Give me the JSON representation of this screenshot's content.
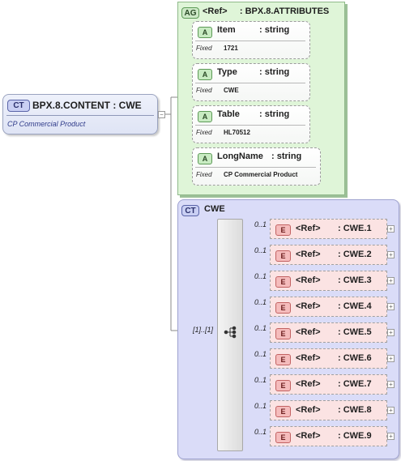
{
  "root": {
    "badge": "CT",
    "title": "BPX.8.CONTENT : CWE",
    "doc": "CP Commercial Product"
  },
  "attribute_group": {
    "badge": "AG",
    "title": "<Ref>     : BPX.8.ATTRIBUTES",
    "attributes": [
      {
        "badge": "A",
        "name": "Item",
        "type": ": string",
        "fixed_label": "Fixed",
        "fixed_value": "1721"
      },
      {
        "badge": "A",
        "name": "Type",
        "type": ": string",
        "fixed_label": "Fixed",
        "fixed_value": "CWE"
      },
      {
        "badge": "A",
        "name": "Table",
        "type": ": string",
        "fixed_label": "Fixed",
        "fixed_value": "HL70512"
      },
      {
        "badge": "A",
        "name": "LongName",
        "type": ": string",
        "fixed_label": "Fixed",
        "fixed_value": "CP Commercial Product"
      }
    ]
  },
  "complex_type": {
    "badge": "CT",
    "title": "CWE",
    "sequence_cardinality": "[1]..[1]",
    "elements": [
      {
        "badge": "E",
        "ref": "<Ref>",
        "type": ": CWE.1",
        "cardinality": "0..1"
      },
      {
        "badge": "E",
        "ref": "<Ref>",
        "type": ": CWE.2",
        "cardinality": "0..1"
      },
      {
        "badge": "E",
        "ref": "<Ref>",
        "type": ": CWE.3",
        "cardinality": "0..1"
      },
      {
        "badge": "E",
        "ref": "<Ref>",
        "type": ": CWE.4",
        "cardinality": "0..1"
      },
      {
        "badge": "E",
        "ref": "<Ref>",
        "type": ": CWE.5",
        "cardinality": "0..1"
      },
      {
        "badge": "E",
        "ref": "<Ref>",
        "type": ": CWE.6",
        "cardinality": "0..1"
      },
      {
        "badge": "E",
        "ref": "<Ref>",
        "type": ": CWE.7",
        "cardinality": "0..1"
      },
      {
        "badge": "E",
        "ref": "<Ref>",
        "type": ": CWE.8",
        "cardinality": "0..1"
      },
      {
        "badge": "E",
        "ref": "<Ref>",
        "type": ": CWE.9",
        "cardinality": "0..1"
      }
    ]
  },
  "icons": {
    "expand": "plus-icon",
    "collapse": "minus-icon",
    "sequence": "sequence-icon"
  },
  "colors": {
    "complex_type_fill": "#dadcf8",
    "attribute_group_fill": "#dff5d8",
    "element_fill": "#fbe3e3"
  }
}
